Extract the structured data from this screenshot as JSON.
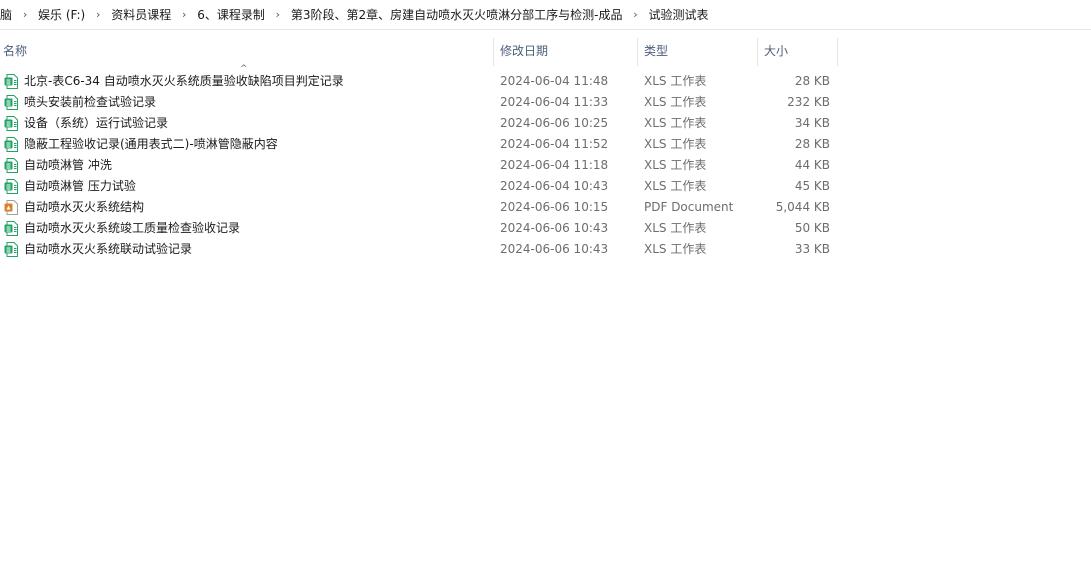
{
  "breadcrumb": {
    "items": [
      "脑",
      "娱乐 (F:)",
      "资料员课程",
      "6、课程录制",
      "第3阶段、第2章、房建自动喷水灭火喷淋分部工序与检测-成品",
      "试验测试表"
    ],
    "separator": "›"
  },
  "columns": {
    "name": "名称",
    "date": "修改日期",
    "type": "类型",
    "size": "大小"
  },
  "sort_indicator": "^",
  "colors": {
    "xls_icon": "#21a366",
    "pdf_icon": "#d9822b",
    "header_text": "#4c607a"
  },
  "files": [
    {
      "name": "北京-表C6-34 自动喷水灭火系统质量验收缺陷项目判定记录",
      "date": "2024-06-04 11:48",
      "type": "XLS 工作表",
      "size": "28 KB",
      "icon": "xls-icon"
    },
    {
      "name": "喷头安装前检查试验记录",
      "date": "2024-06-04 11:33",
      "type": "XLS 工作表",
      "size": "232 KB",
      "icon": "xls-icon"
    },
    {
      "name": "设备（系统）运行试验记录",
      "date": "2024-06-06 10:25",
      "type": "XLS 工作表",
      "size": "34 KB",
      "icon": "xls-icon"
    },
    {
      "name": "隐蔽工程验收记录(通用表式二)-喷淋管隐蔽内容",
      "date": "2024-06-04 11:52",
      "type": "XLS 工作表",
      "size": "28 KB",
      "icon": "xls-icon"
    },
    {
      "name": "自动喷淋管 冲洗",
      "date": "2024-06-04 11:18",
      "type": "XLS 工作表",
      "size": "44 KB",
      "icon": "xls-icon"
    },
    {
      "name": "自动喷淋管 压力试验",
      "date": "2024-06-04 10:43",
      "type": "XLS 工作表",
      "size": "45 KB",
      "icon": "xls-icon"
    },
    {
      "name": "自动喷水灭火系统结构",
      "date": "2024-06-06 10:15",
      "type": "PDF Document",
      "size": "5,044 KB",
      "icon": "pdf-icon"
    },
    {
      "name": "自动喷水灭火系统竣工质量检查验收记录",
      "date": "2024-06-06 10:43",
      "type": "XLS 工作表",
      "size": "50 KB",
      "icon": "xls-icon"
    },
    {
      "name": "自动喷水灭火系统联动试验记录",
      "date": "2024-06-06 10:43",
      "type": "XLS 工作表",
      "size": "33 KB",
      "icon": "xls-icon"
    }
  ]
}
